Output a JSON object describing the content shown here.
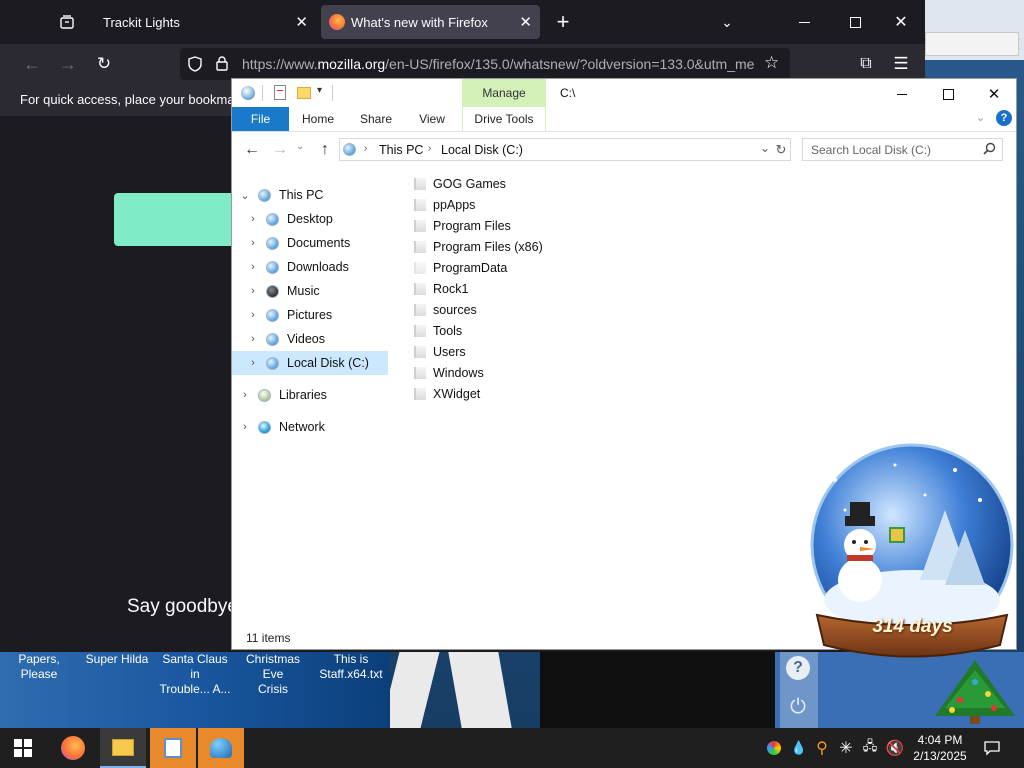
{
  "firefox": {
    "tabs": [
      {
        "label": "Trackit Lights",
        "active": false
      },
      {
        "label": "What's new with Firefox",
        "active": true
      }
    ],
    "url_host": "https://www.",
    "url_domain": "mozilla.org",
    "url_path": "/en-US/firefox/135.0/whatsnew/?oldversion=133.0&utm_me",
    "bookmarks_hint": "For quick access, place your bookmarks",
    "page_text": "Say goodbye"
  },
  "explorer": {
    "quick_access_path": "C:\\",
    "ribbon": {
      "manage": "Manage",
      "tabs": [
        "File",
        "Home",
        "Share",
        "View",
        "Drive Tools"
      ]
    },
    "breadcrumb": [
      "This PC",
      "Local Disk (C:)"
    ],
    "search_placeholder": "Search Local Disk (C:)",
    "tree": [
      {
        "label": "This PC",
        "level": 0,
        "expanded": true
      },
      {
        "label": "Desktop",
        "level": 1
      },
      {
        "label": "Documents",
        "level": 1
      },
      {
        "label": "Downloads",
        "level": 1
      },
      {
        "label": "Music",
        "level": 1
      },
      {
        "label": "Pictures",
        "level": 1
      },
      {
        "label": "Videos",
        "level": 1
      },
      {
        "label": "Local Disk (C:)",
        "level": 1,
        "selected": true
      },
      {
        "label": "Libraries",
        "level": 0
      },
      {
        "label": "Network",
        "level": 0
      }
    ],
    "files": [
      "GOG Games",
      "ppApps",
      "Program Files",
      "Program Files (x86)",
      "ProgramData",
      "Rock1",
      "sources",
      "Tools",
      "Users",
      "Windows",
      "XWidget"
    ],
    "status": "11 items"
  },
  "desktop_icons": [
    {
      "line1": "Papers, Please",
      "line2": ""
    },
    {
      "line1": "Super Hilda",
      "line2": ""
    },
    {
      "line1": "Santa Claus in",
      "line2": "Trouble... A..."
    },
    {
      "line1": "Christmas Eve",
      "line2": "Crisis"
    },
    {
      "line1": "This is",
      "line2": "Staff.x64.txt"
    }
  ],
  "widget": {
    "days": "314 days"
  },
  "taskbar": {
    "time": "4:04 PM",
    "date": "2/13/2025"
  },
  "colors": {
    "ribbon_file_blue": "#1979ca",
    "manage_green": "#d4f0b9",
    "selection_blue": "#cce8ff",
    "ff_dark": "#1c1b22",
    "taskbar": "#1f1f1f"
  }
}
